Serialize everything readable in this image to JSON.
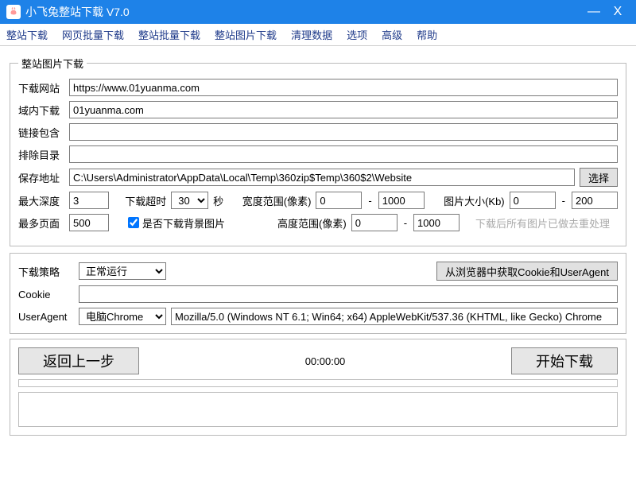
{
  "title": "小飞兔整站下载 V7.0",
  "menu": [
    "整站下载",
    "网页批量下载",
    "整站批量下载",
    "整站图片下载",
    "清理数据",
    "选项",
    "高级",
    "帮助"
  ],
  "group": {
    "legend": "整站图片下载",
    "url_label": "下载网站",
    "url": "https://www.01yuanma.com",
    "domain_label": "域内下载",
    "domain": "01yuanma.com",
    "contain_label": "链接包含",
    "contain": "",
    "exclude_label": "排除目录",
    "exclude": "",
    "save_label": "保存地址",
    "save": "C:\\Users\\Administrator\\AppData\\Local\\Temp\\360zip$Temp\\360$2\\Website",
    "choose": "选择",
    "depth_label": "最大深度",
    "depth": "3",
    "timeout_label": "下载超时",
    "timeout": "30",
    "timeout_unit": "秒",
    "width_label": "宽度范围(像素)",
    "width_min": "0",
    "width_max": "1000",
    "size_label": "图片大小(Kb)",
    "size_min": "0",
    "size_max": "200",
    "pages_label": "最多页面",
    "pages": "500",
    "bgimg_label": "是否下载背景图片",
    "height_label": "高度范围(像素)",
    "height_min": "0",
    "height_max": "1000",
    "dedup_hint": "下载后所有图片已做去重处理"
  },
  "net": {
    "policy_label": "下载策略",
    "policy": "正常运行",
    "fetch_cookie": "从浏览器中获取Cookie和UserAgent",
    "cookie_label": "Cookie",
    "cookie": "",
    "ua_label": "UserAgent",
    "ua_preset": "电脑Chrome",
    "ua": "Mozilla/5.0 (Windows NT 6.1; Win64; x64) AppleWebKit/537.36 (KHTML, like Gecko) Chrome"
  },
  "footer": {
    "back": "返回上一步",
    "time": "00:00:00",
    "start": "开始下载"
  }
}
